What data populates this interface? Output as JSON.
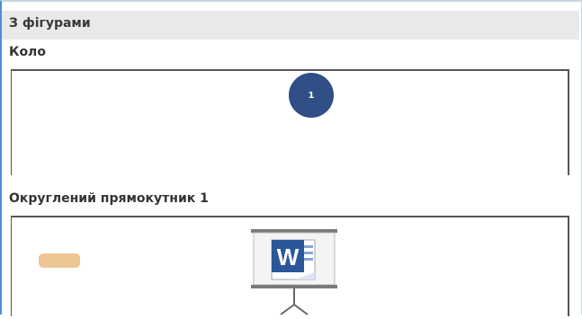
{
  "group": {
    "title": "З фігурами"
  },
  "sections": [
    {
      "label": "Коло",
      "shape": "circle",
      "shape_text": "1",
      "shape_color": "#2f4f86"
    },
    {
      "label": "Округлений прямокутник 1",
      "shape": "rounded-rectangle",
      "shape_color": "#eec694",
      "icon": "word-presentation-icon"
    }
  ],
  "colors": {
    "accent_border": "#4a90d9",
    "header_background": "#e9e9e9",
    "word_blue": "#2b579a"
  }
}
